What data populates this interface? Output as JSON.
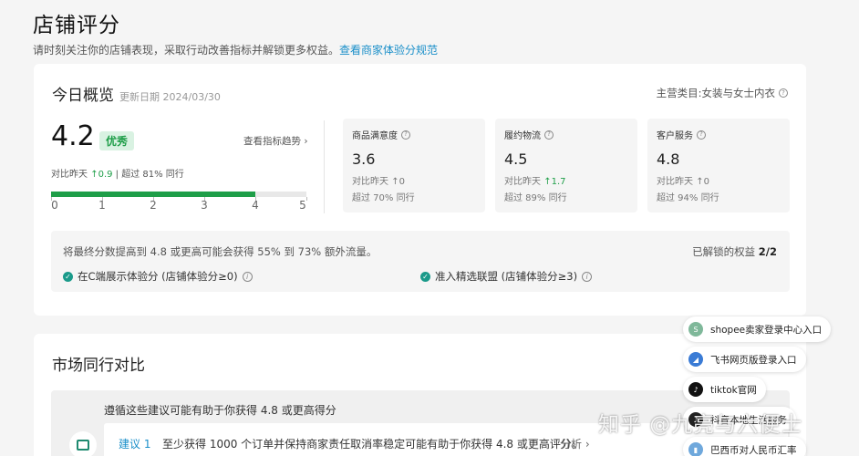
{
  "header": {
    "title": "店铺评分",
    "subtitle": "请时刻关注你的店铺表现，采取行动改善指标并解锁更多权益。",
    "link": "查看商家体验分规范"
  },
  "today": {
    "title": "今日概览",
    "date": "更新日期 2024/03/30",
    "category": "主营类目:女装与女士内衣",
    "score": "4.2",
    "badge": "优秀",
    "trend_link": "查看指标趋势 ›",
    "compare_label": "对比昨天",
    "compare_delta": "0.9",
    "compare_exceed": "| 超过 81% 同行",
    "progress": 0.8,
    "scale_labels": [
      "0",
      "1",
      "2",
      "3",
      "4",
      "5"
    ],
    "metrics": [
      {
        "name": "商品满意度",
        "value": "3.6",
        "cmp_label": "对比昨天",
        "cmp_delta": "0",
        "cmp_up": false,
        "pct": "超过 70% 同行"
      },
      {
        "name": "履约物流",
        "value": "4.5",
        "cmp_label": "对比昨天",
        "cmp_delta": "1.7",
        "cmp_up": true,
        "pct": "超过 89% 同行"
      },
      {
        "name": "客户服务",
        "value": "4.8",
        "cmp_label": "对比昨天",
        "cmp_delta": "0",
        "cmp_up": false,
        "pct": "超过 94% 同行"
      }
    ],
    "boost_text": "将最终分数提高到 4.8 或更高可能会获得 55% 到 73% 额外流量。",
    "unlock_label": "已解锁的权益",
    "unlock_count": "2/2",
    "benefits": [
      "在C端展示体验分 (店铺体验分≥0)",
      "准入精选联盟 (店铺体验分≥3)"
    ]
  },
  "market": {
    "title": "市场同行对比",
    "suggest_head": "遵循这些建议可能有助于你获得 4.8 或更高得分",
    "suggest_label": "建议 1",
    "suggest_text": "至少获得 1000 个订单并保持商家责任取消率稳定可能有助于你获得 4.8 或更高评分。",
    "suggest_action": "分析 ›"
  },
  "popups": [
    {
      "label": "shopee卖家登录中心入口",
      "icon": "shopee-icon",
      "color": "#7fb89a"
    },
    {
      "label": "飞书网页版登录入口",
      "icon": "feishu-icon",
      "color": "#3a7bd5"
    },
    {
      "label": "tiktok官网",
      "icon": "tiktok-icon",
      "color": "#111111"
    },
    {
      "label": "抖音本地生活服务",
      "icon": "douyin-icon",
      "color": "#222222"
    },
    {
      "label": "巴西币对人民币汇率",
      "icon": "chart-icon",
      "color": "#6fa8dc"
    }
  ],
  "watermark": "知乎 @九亮与六便士"
}
